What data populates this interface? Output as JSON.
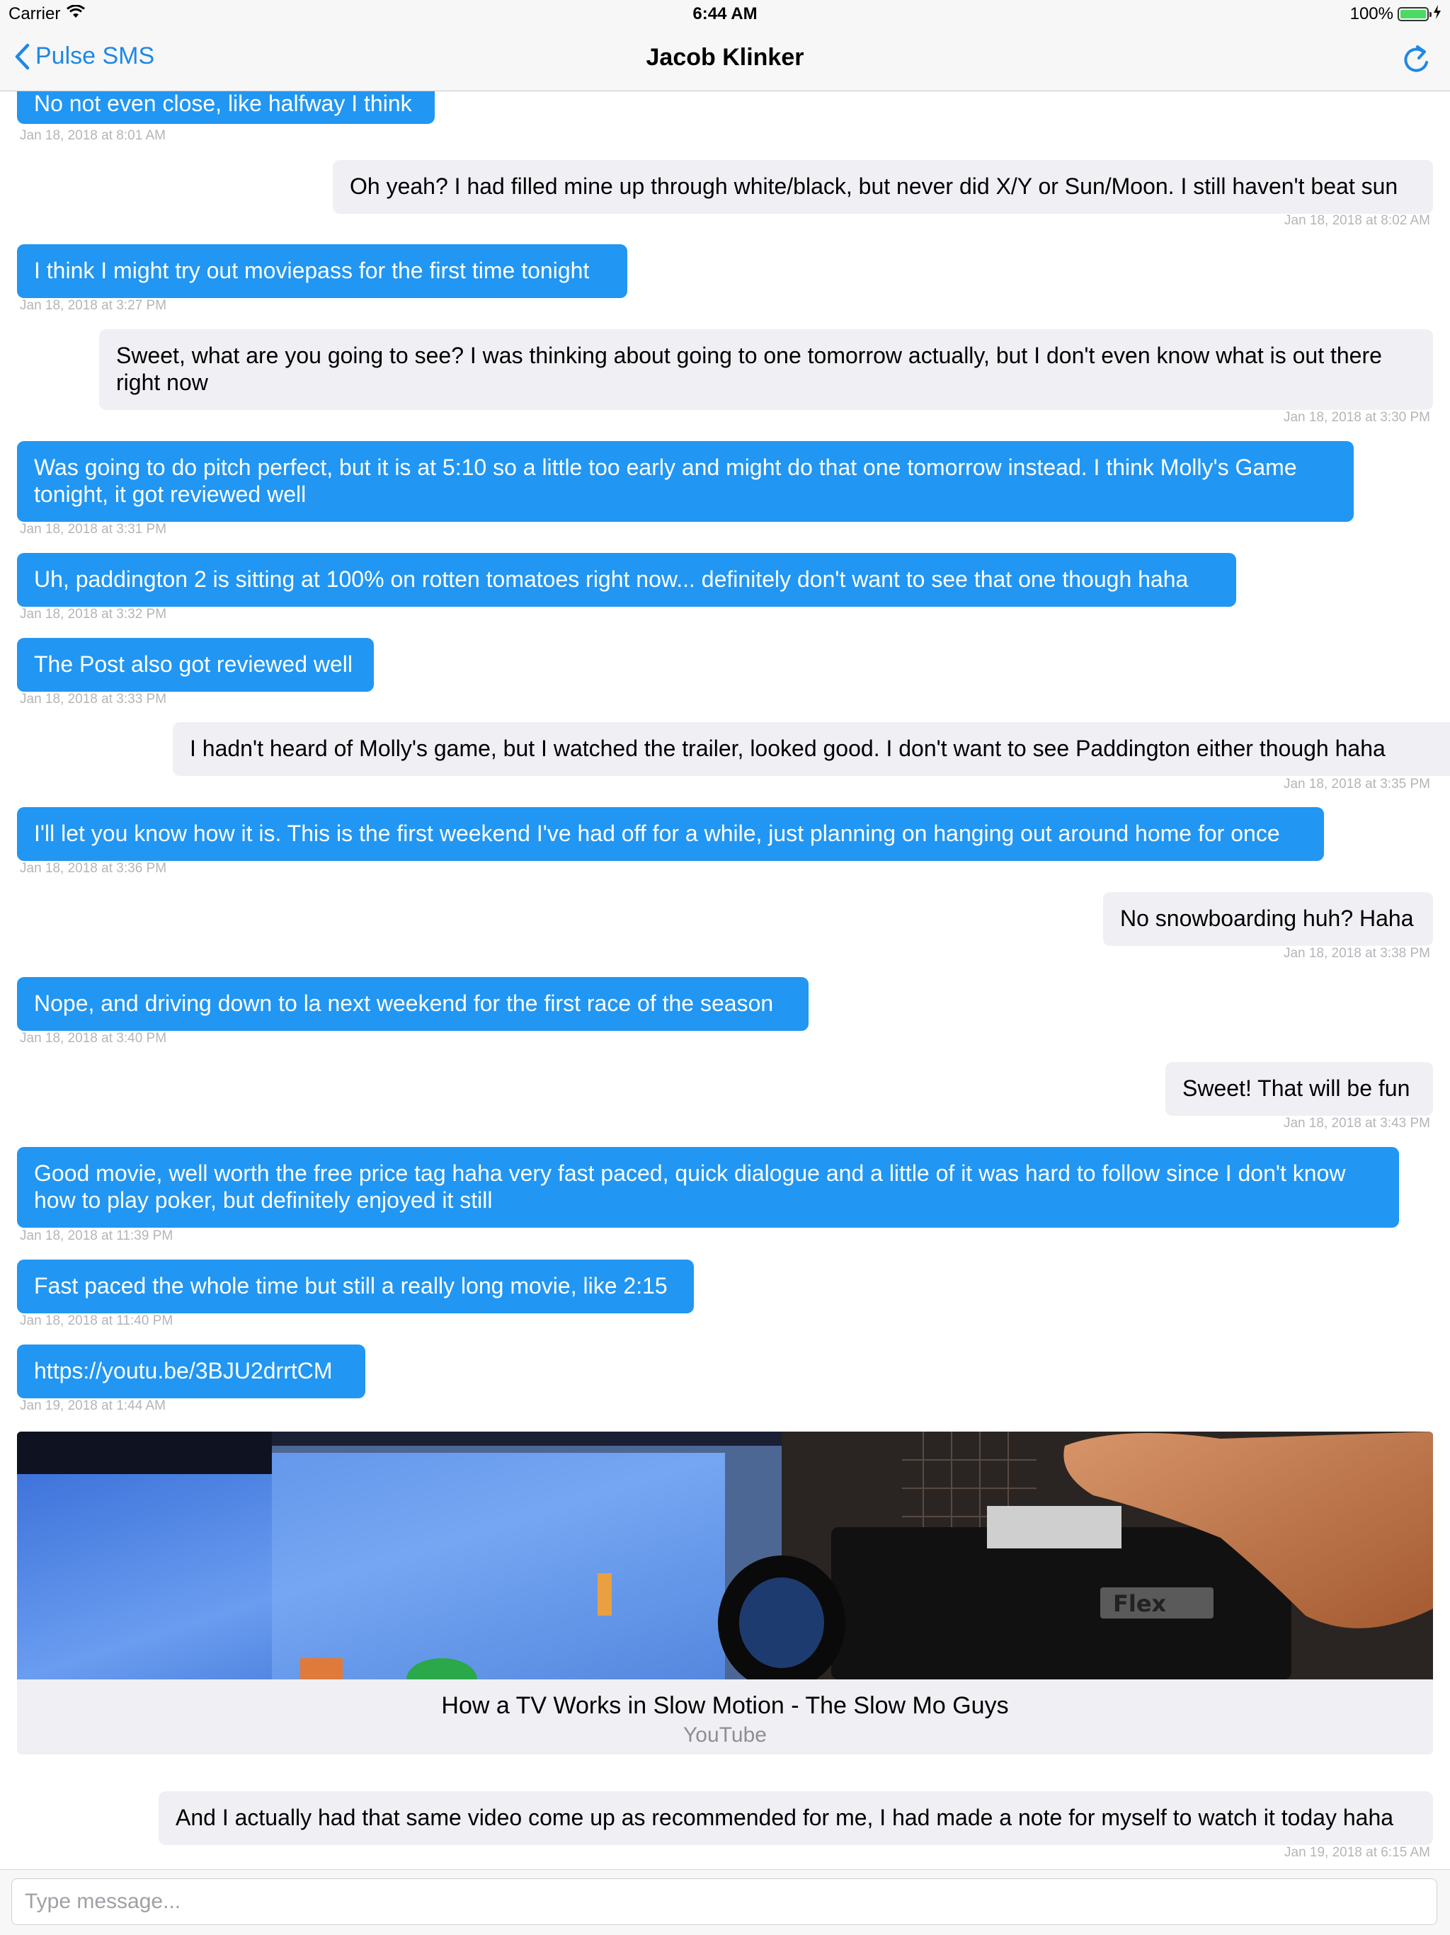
{
  "status_bar": {
    "carrier": "Carrier",
    "time": "6:44 AM",
    "battery_percent": "100%",
    "battery_level": 1.0,
    "wifi_icon": "wifi-icon",
    "charging_icon": "bolt-icon"
  },
  "nav": {
    "back_label": "Pulse SMS",
    "title": "Jacob Klinker",
    "refresh_icon": "refresh-icon",
    "accent": "#1e88e5"
  },
  "colors": {
    "incoming_bubble": "#2196f3",
    "outgoing_bubble": "#efeff4"
  },
  "messages": [
    {
      "dir": "in",
      "text": "No not even close, like halfway I think",
      "ts": "Jan 18, 2018 at 8:01 AM"
    },
    {
      "dir": "out",
      "text": "Oh yeah? I had filled mine up through white/black, but never did X/Y or Sun/Moon. I still haven't beat sun",
      "ts": "Jan 18, 2018 at 8:02 AM"
    },
    {
      "dir": "in",
      "text": "I think I might try out moviepass for the first time tonight",
      "ts": "Jan 18, 2018 at 3:27 PM"
    },
    {
      "dir": "out",
      "text": "Sweet, what are you going to see? I was thinking about going to one tomorrow actually, but I don't even know what is out there right now",
      "ts": "Jan 18, 2018 at 3:30 PM"
    },
    {
      "dir": "in",
      "text": "Was going to do pitch perfect, but it is at 5:10 so a little too early and might do that one tomorrow instead. I think Molly's Game tonight, it got reviewed well",
      "ts": "Jan 18, 2018 at 3:31 PM"
    },
    {
      "dir": "in",
      "text": "Uh, paddington 2 is sitting at 100% on rotten tomatoes right now... definitely don't want to see that one though haha",
      "ts": "Jan 18, 2018 at 3:32 PM"
    },
    {
      "dir": "in",
      "text": "The Post also got reviewed well",
      "ts": "Jan 18, 2018 at 3:33 PM"
    },
    {
      "dir": "out",
      "text": "I hadn't heard of Molly's game, but I watched the trailer, looked good. I don't want to see Paddington either though haha",
      "ts": "Jan 18, 2018 at 3:35 PM"
    },
    {
      "dir": "in",
      "text": "I'll let you know how it is. This is the first weekend I've had off for a while, just planning on hanging out around home for once",
      "ts": "Jan 18, 2018 at 3:36 PM"
    },
    {
      "dir": "out",
      "text": "No snowboarding huh? Haha",
      "ts": "Jan 18, 2018 at 3:38 PM"
    },
    {
      "dir": "in",
      "text": "Nope, and driving down to la next weekend for the first race of the season",
      "ts": "Jan 18, 2018 at 3:40 PM"
    },
    {
      "dir": "out",
      "text": "Sweet! That will be fun",
      "ts": "Jan 18, 2018 at 3:43 PM"
    },
    {
      "dir": "in",
      "text": "Good movie, well worth the free price tag haha very fast paced, quick dialogue and a little of it was hard to follow since I don't know how to play poker, but definitely enjoyed it still",
      "ts": "Jan 18, 2018 at 11:39 PM"
    },
    {
      "dir": "in",
      "text": "Fast paced the whole time but still a really long movie, like 2:15",
      "ts": "Jan 18, 2018 at 11:40 PM"
    },
    {
      "dir": "in",
      "text": "https://youtu.be/3BJU2drrtCM",
      "ts": "Jan 19, 2018 at 1:44 AM"
    },
    {
      "dir": "out",
      "text": "And I actually had that same video come up as recommended for me, I had made a note for myself to watch it today haha",
      "ts": "Jan 19, 2018 at 6:15 AM"
    }
  ],
  "link_preview": {
    "title": "How a TV Works in Slow Motion - The Slow Mo Guys",
    "source": "YouTube",
    "camera_brand": "Flex"
  },
  "composer": {
    "placeholder": "Type message..."
  }
}
